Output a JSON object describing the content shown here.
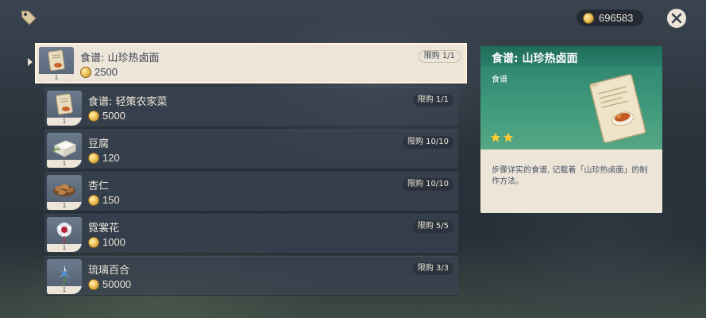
{
  "header": {
    "currency_amount": "696583",
    "icons": {
      "shop": "tag-icon",
      "currency": "mora-coin-icon",
      "close": "close-icon"
    }
  },
  "shop_items": [
    {
      "name": "食谱: 山珍热卤面",
      "price": "2500",
      "limit": "限购 1/1",
      "qty": "1",
      "icon": "recipe-icon",
      "selected": true
    },
    {
      "name": "食谱: 轻策农家菜",
      "price": "5000",
      "limit": "限购 1/1",
      "qty": "1",
      "icon": "recipe-icon",
      "selected": false
    },
    {
      "name": "豆腐",
      "price": "120",
      "limit": "限购 10/10",
      "qty": "1",
      "icon": "tofu-icon",
      "selected": false
    },
    {
      "name": "杏仁",
      "price": "150",
      "limit": "限购 10/10",
      "qty": "1",
      "icon": "almond-icon",
      "selected": false
    },
    {
      "name": "霓裳花",
      "price": "1000",
      "limit": "限购 5/5",
      "qty": "1",
      "icon": "silk-flower-icon",
      "selected": false
    },
    {
      "name": "琉璃百合",
      "price": "50000",
      "limit": "限购 3/3",
      "qty": "1",
      "icon": "glaze-lily-icon",
      "selected": false
    }
  ],
  "detail": {
    "title": "食谱: 山珍热卤面",
    "type": "食谱",
    "rarity": 2,
    "description": "步骤详实的食谱, 记载着「山珍热卤面」的制作方法。"
  },
  "colors": {
    "detail_header": "#2b7f6b",
    "panel_cream": "#ece5d8",
    "row_bg": "#3a4452",
    "star": "#ffcc33",
    "coin": "#f0c45a"
  }
}
